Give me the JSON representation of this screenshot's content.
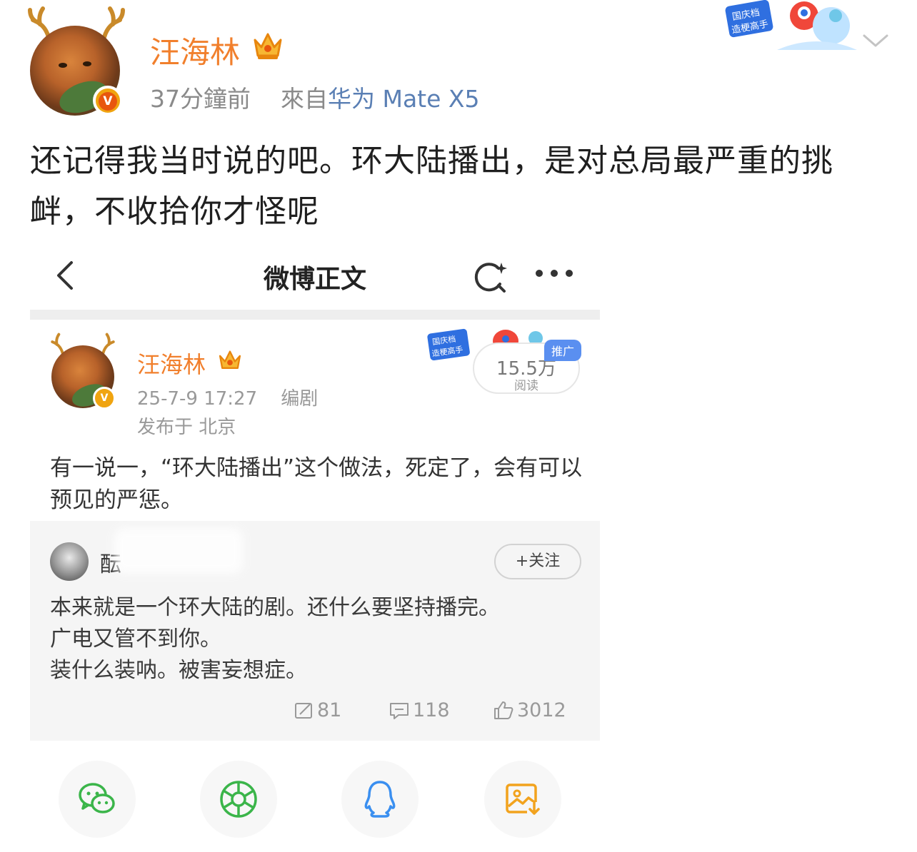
{
  "post": {
    "author": "汪海林",
    "time": "37分鐘前",
    "source_prefix": "來自",
    "device": "华为 Mate X5",
    "text": "还记得我当时说的吧。环大陆播出，是对总局最严重的挑衅，不收拾你才怪呢"
  },
  "embedded": {
    "nav_title": "微博正文",
    "author": "汪海林",
    "date": "25-7-9 17:27",
    "edit_label": "编剧",
    "location": "发布于 北京",
    "reads_count": "15.5万",
    "reads_label": "阅读",
    "reads_tag": "推广",
    "text": "有一说一，“环大陆播出”这个做法，死定了，会有可以预见的严惩。",
    "repost": {
      "name": "酝",
      "follow_label": "+关注",
      "lines": [
        "本来就是一个环大陆的剧。还什么要坚持播完。",
        "广电又管不到你。",
        "装什么装呐。被害妄想症。"
      ],
      "reposts": "81",
      "comments": "118",
      "likes": "3012"
    }
  },
  "colors": {
    "username": "#f17f2c",
    "device_link": "#5a7fb4",
    "verified": "#f0a410"
  },
  "icons": [
    "antler-icon",
    "crown-icon",
    "verified-badge-icon",
    "chevron-down-icon",
    "back-icon",
    "refresh-icon",
    "more-icon",
    "repost-icon",
    "comment-icon",
    "like-icon",
    "wechat-icon",
    "moments-icon",
    "qq-icon",
    "save-image-icon"
  ]
}
